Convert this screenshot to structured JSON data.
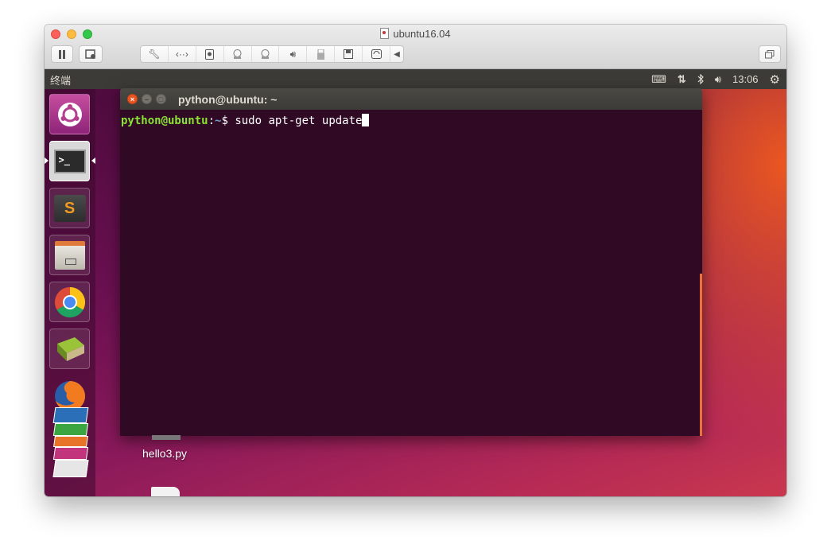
{
  "host_window": {
    "title": "ubuntu16.04",
    "toolbar_buttons": [
      "pause",
      "screen-record",
      "wrench",
      "network",
      "hard-disk",
      "camera",
      "camera",
      "speaker",
      "usb",
      "save",
      "sync"
    ]
  },
  "ubuntu": {
    "topbar_title": "终端",
    "clock": "13:06",
    "launcher_items": [
      "ubuntu-dash",
      "terminal",
      "sublime-text",
      "files",
      "chrome",
      "books",
      "firefox",
      "libreoffice-writer",
      "libreoffice-calc",
      "libreoffice-impress",
      "software-center",
      "disk"
    ]
  },
  "terminal": {
    "title": "python@ubuntu: ~",
    "prompt_user": "python@ubuntu",
    "prompt_colon": ":",
    "prompt_path": "~",
    "prompt_symbol": "$ ",
    "command": "sudo apt-get update"
  },
  "desktop_files": [
    {
      "label": "hello3.py"
    }
  ],
  "colors": {
    "terminal_bg": "#300a24",
    "prompt_user": "#8ae234",
    "prompt_path": "#729fcf",
    "unity_panel": "#3c3b37"
  }
}
